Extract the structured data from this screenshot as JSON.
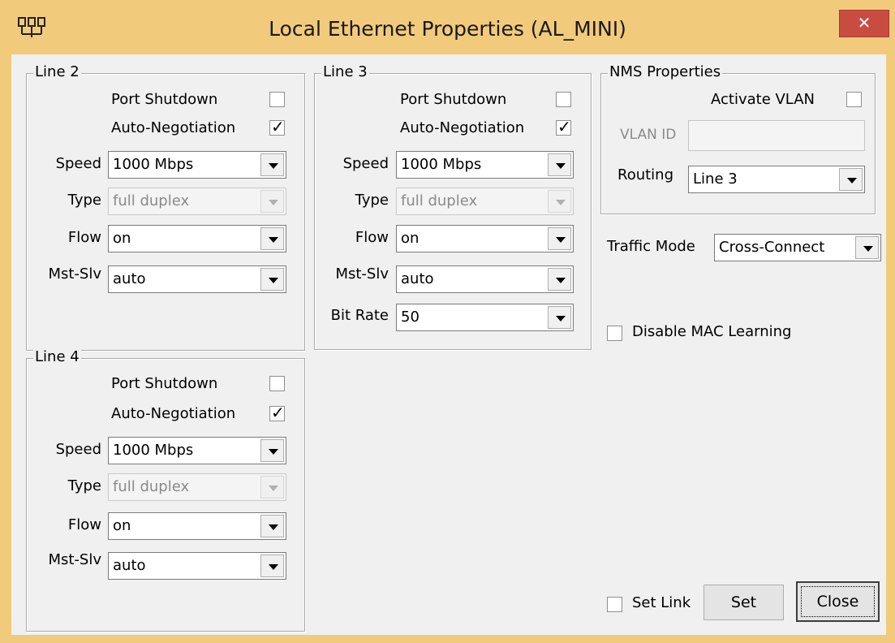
{
  "window": {
    "title": "Local Ethernet Properties (AL_MINI)",
    "close_glyph": "✕",
    "app_icon": "network-adapter-icon"
  },
  "line2": {
    "title": "Line 2",
    "port_shutdown": {
      "label": "Port Shutdown",
      "checked": false
    },
    "auto_negotiation": {
      "label": "Auto-Negotiation",
      "checked": true
    },
    "speed": {
      "label": "Speed",
      "value": "1000 Mbps"
    },
    "type": {
      "label": "Type",
      "value": "full duplex",
      "enabled": false
    },
    "flow": {
      "label": "Flow",
      "value": "on"
    },
    "mst_slv": {
      "label": "Mst-Slv",
      "value": "auto"
    }
  },
  "line3": {
    "title": "Line 3",
    "port_shutdown": {
      "label": "Port Shutdown",
      "checked": false
    },
    "auto_negotiation": {
      "label": "Auto-Negotiation",
      "checked": true
    },
    "speed": {
      "label": "Speed",
      "value": "1000 Mbps"
    },
    "type": {
      "label": "Type",
      "value": "full duplex",
      "enabled": false
    },
    "flow": {
      "label": "Flow",
      "value": "on"
    },
    "mst_slv": {
      "label": "Mst-Slv",
      "value": "auto"
    },
    "bit_rate": {
      "label": "Bit Rate",
      "value": "50"
    }
  },
  "line4": {
    "title": "Line 4",
    "port_shutdown": {
      "label": "Port Shutdown",
      "checked": false
    },
    "auto_negotiation": {
      "label": "Auto-Negotiation",
      "checked": true
    },
    "speed": {
      "label": "Speed",
      "value": "1000 Mbps"
    },
    "type": {
      "label": "Type",
      "value": "full duplex",
      "enabled": false
    },
    "flow": {
      "label": "Flow",
      "value": "on"
    },
    "mst_slv": {
      "label": "Mst-Slv",
      "value": "auto"
    }
  },
  "nms": {
    "title": "NMS Properties",
    "activate_vlan": {
      "label": "Activate VLAN",
      "checked": false
    },
    "vlan_id": {
      "label": "VLAN ID",
      "value": "",
      "enabled": false
    },
    "routing": {
      "label": "Routing",
      "value": "Line 3"
    }
  },
  "traffic_mode": {
    "label": "Traffic Mode",
    "value": "Cross-Connect"
  },
  "disable_mac": {
    "label": "Disable MAC Learning",
    "checked": false
  },
  "footer": {
    "set_link": {
      "label": "Set Link",
      "checked": false
    },
    "set_button": "Set",
    "close_button": "Close"
  },
  "check_glyph": "✓",
  "colors": {
    "title_bar": "#f1ca7c",
    "close_button": "#c94c41",
    "dialog_bg": "#f0f0f0"
  }
}
